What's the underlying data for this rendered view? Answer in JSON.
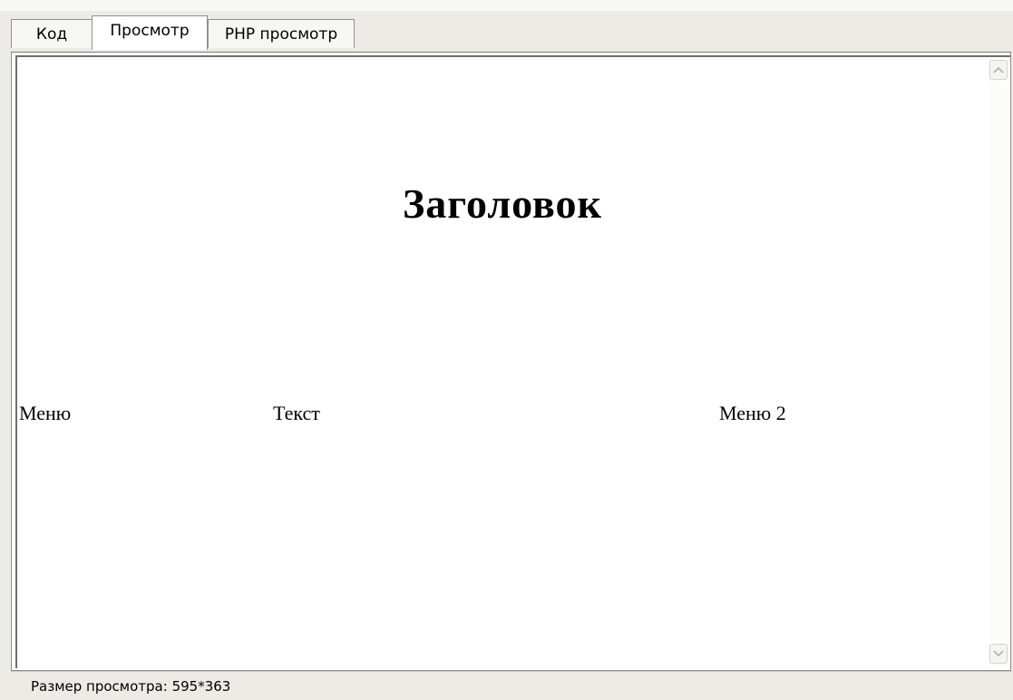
{
  "tabs": [
    {
      "label": "Код",
      "active": false
    },
    {
      "label": "Просмотр",
      "active": true
    },
    {
      "label": "PHP просмотр",
      "active": false
    }
  ],
  "preview": {
    "heading": "Заголовок",
    "menu_left": "Меню",
    "content_text": "Текст",
    "menu_right": "Меню 2"
  },
  "scrollbar": {
    "up_icon": "chevron-up-icon",
    "down_icon": "chevron-down-icon"
  },
  "status": {
    "text": "Размер просмотра: 595*363"
  }
}
